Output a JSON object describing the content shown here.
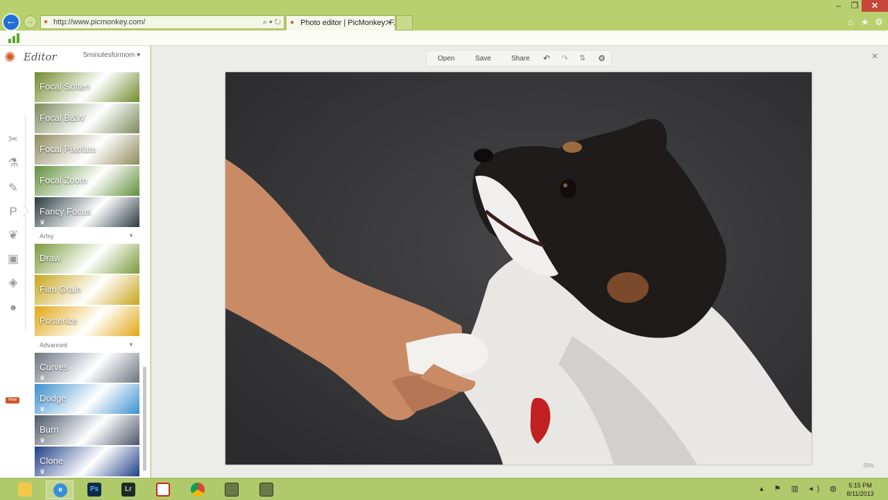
{
  "browser": {
    "address": "http://www.picmonkey.com/",
    "tab_title": "Photo editor | PicMonkey: F...",
    "tab_close": "✕",
    "back_label": "←",
    "forward_label": "→",
    "min_label": "–",
    "max_label": "❐",
    "close_label": "✕"
  },
  "editor": {
    "title": "Editor",
    "account": "5minutesformom ▾",
    "new_badge": "New"
  },
  "effects": {
    "focal": [
      {
        "label": "Focal Soften",
        "premium": false,
        "bg": "#6f8a2c"
      },
      {
        "label": "Focal B&W",
        "premium": false,
        "bg": "#7a8a5a"
      },
      {
        "label": "Focal Pixelate",
        "premium": false,
        "bg": "#8f8a5c"
      },
      {
        "label": "Focal Zoom",
        "premium": false,
        "bg": "#5f8f3a"
      },
      {
        "label": "Fancy Focus",
        "premium": true,
        "bg": "#2a3a40"
      }
    ],
    "artsy_header": "Artsy",
    "artsy": [
      {
        "label": "Draw",
        "premium": false,
        "bg": "#7a9a3a"
      },
      {
        "label": "Film Grain",
        "premium": false,
        "bg": "#c9a51a"
      },
      {
        "label": "Posterize",
        "premium": false,
        "bg": "#e2a713"
      }
    ],
    "advanced_header": "Advanced",
    "advanced": [
      {
        "label": "Curves",
        "premium": true,
        "bg": "#6a7480"
      },
      {
        "label": "Dodge",
        "premium": true,
        "bg": "#3a8fcf"
      },
      {
        "label": "Burn",
        "premium": true,
        "bg": "#4a5668"
      },
      {
        "label": "Clone",
        "premium": true,
        "bg": "#1f3f86"
      }
    ]
  },
  "toolbar": {
    "open": "Open",
    "save": "Save",
    "share": "Share"
  },
  "canvas": {
    "zoom": "35%"
  },
  "taskbar": {
    "apps": [
      "File Explorer",
      "Internet Explorer",
      "Photoshop",
      "Lightroom",
      "App",
      "Chrome",
      "App",
      "App"
    ],
    "ps_label": "Ps",
    "lr_label": "Lr",
    "time": "5:15 PM",
    "date": "8/11/2013"
  }
}
